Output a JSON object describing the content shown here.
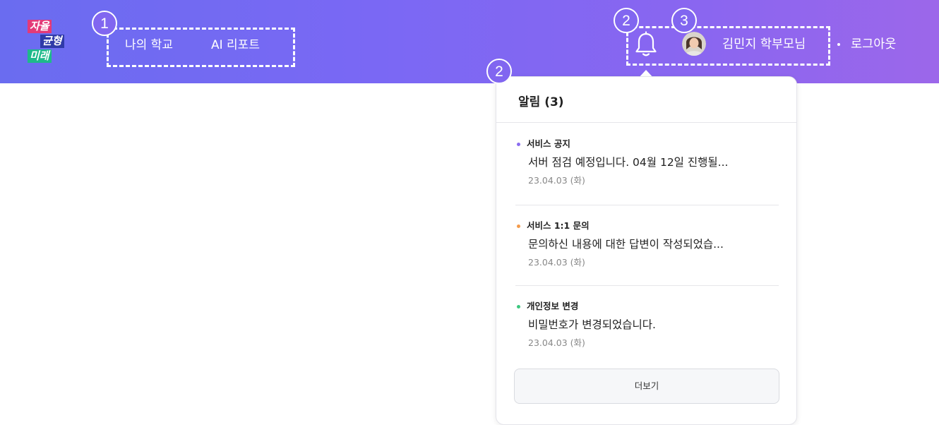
{
  "logo": {
    "line1": "자율",
    "line2": "균형",
    "line3": "미래"
  },
  "nav": {
    "my_school": "나의 학교",
    "ai_report": "AI 리포트"
  },
  "annotations": {
    "nav_marker": "1",
    "bell_marker": "2",
    "panel_marker": "2",
    "user_marker": "3"
  },
  "user": {
    "name": "김민지 학부모님",
    "logout": "로그아웃"
  },
  "icons": {
    "bell": "bell-icon",
    "avatar": "user-avatar",
    "separator": "dot"
  },
  "notifications": {
    "title": "알림 (3)",
    "items": [
      {
        "category": "서비스 공지",
        "message": "서버 점검 예정입니다. 04월 12일 진행될...",
        "date": "23.04.03 (화)",
        "dot_color": "#8a6cf0"
      },
      {
        "category": "서비스 1:1 문의",
        "message": "문의하신 내용에 대한 답변이 작성되었습...",
        "date": "23.04.03 (화)",
        "dot_color": "#f49a4a"
      },
      {
        "category": "개인정보 변경",
        "message": "비밀번호가 변경되었습니다.",
        "date": "23.04.03 (화)",
        "dot_color": "#3cc77e"
      }
    ],
    "more_label": "더보기"
  },
  "colors": {
    "header_start": "#6a6cf0",
    "header_end": "#9c67ea",
    "annotation": "#ffffff"
  }
}
